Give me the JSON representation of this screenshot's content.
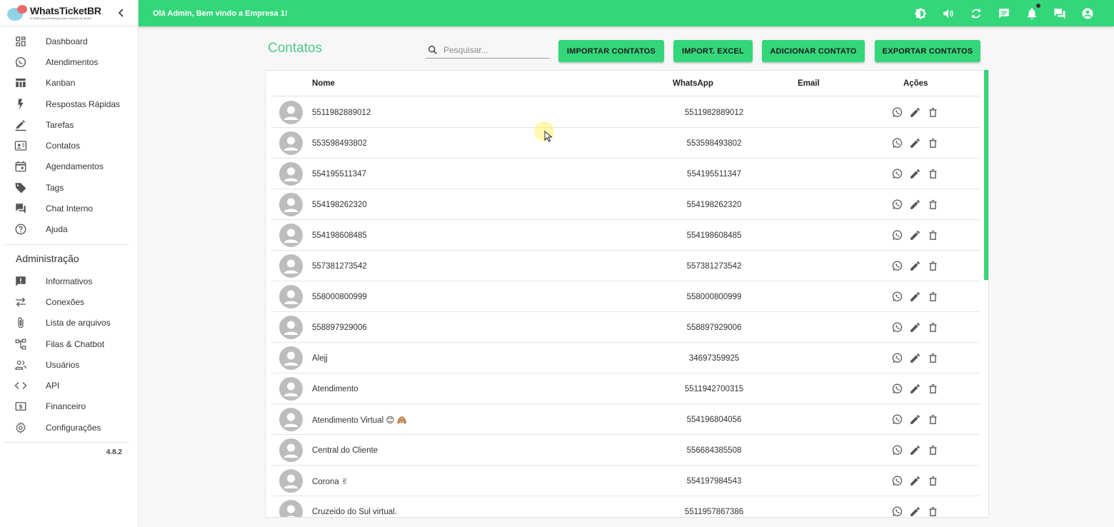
{
  "brand": {
    "name": "WhatsTicketBR",
    "tagline": "O CRM para WhatsApp mais completo do Brasil"
  },
  "sidebar": {
    "items": [
      {
        "label": "Dashboard",
        "icon": "dashboard-icon"
      },
      {
        "label": "Atendimentos",
        "icon": "whatsapp-icon"
      },
      {
        "label": "Kanban",
        "icon": "kanban-icon"
      },
      {
        "label": "Respostas Rápidas",
        "icon": "flash-icon"
      },
      {
        "label": "Tarefas",
        "icon": "edit-icon"
      },
      {
        "label": "Contatos",
        "icon": "contacts-icon"
      },
      {
        "label": "Agendamentos",
        "icon": "calendar-icon"
      },
      {
        "label": "Tags",
        "icon": "tag-icon"
      },
      {
        "label": "Chat Interno",
        "icon": "forum-icon"
      },
      {
        "label": "Ajuda",
        "icon": "help-icon"
      }
    ],
    "admin_heading": "Administração",
    "admin_items": [
      {
        "label": "Informativos",
        "icon": "announcement-icon"
      },
      {
        "label": "Conexões",
        "icon": "sync-alt-icon"
      },
      {
        "label": "Lista de arquivos",
        "icon": "attach-icon"
      },
      {
        "label": "Filas & Chatbot",
        "icon": "account-tree-icon"
      },
      {
        "label": "Usuários",
        "icon": "people-icon"
      },
      {
        "label": "API",
        "icon": "code-icon"
      },
      {
        "label": "Financeiro",
        "icon": "money-icon"
      },
      {
        "label": "Configurações",
        "icon": "settings-icon"
      }
    ],
    "version": "4.8.2"
  },
  "topbar": {
    "greeting": "Olá Admin, Bem vindo a Empresa 1!"
  },
  "main": {
    "title": "Contatos",
    "search_placeholder": "Pesquisar...",
    "buttons": {
      "import_contacts": "IMPORTAR CONTATOS",
      "import_excel": "IMPORT. EXCEL",
      "add_contact": "ADICIONAR CONTATO",
      "export_contacts": "EXPORTAR CONTATOS"
    }
  },
  "table": {
    "headers": {
      "name": "Nome",
      "whatsapp": "WhatsApp",
      "email": "Email",
      "actions": "Ações"
    },
    "rows": [
      {
        "name": "5511982889012",
        "whatsapp": "5511982889012",
        "email": ""
      },
      {
        "name": "553598493802",
        "whatsapp": "553598493802",
        "email": ""
      },
      {
        "name": "554195511347",
        "whatsapp": "554195511347",
        "email": ""
      },
      {
        "name": "554198262320",
        "whatsapp": "554198262320",
        "email": ""
      },
      {
        "name": "554198608485",
        "whatsapp": "554198608485",
        "email": ""
      },
      {
        "name": "557381273542",
        "whatsapp": "557381273542",
        "email": ""
      },
      {
        "name": "558000800999",
        "whatsapp": "558000800999",
        "email": ""
      },
      {
        "name": "558897929006",
        "whatsapp": "558897929006",
        "email": ""
      },
      {
        "name": "Alejj",
        "whatsapp": "34697359925",
        "email": ""
      },
      {
        "name": "Atendimento",
        "whatsapp": "5511942700315",
        "email": ""
      },
      {
        "name": "Atendimento Virtual 😊 🙈",
        "whatsapp": "554196804056",
        "email": ""
      },
      {
        "name": "Central do Cliente",
        "whatsapp": "556684385508",
        "email": ""
      },
      {
        "name": "Corona ✌",
        "whatsapp": "554197984543",
        "email": ""
      },
      {
        "name": "Cruzeido do Sul virtual.",
        "whatsapp": "5511957867386",
        "email": ""
      }
    ]
  },
  "colors": {
    "accent": "#34d67a",
    "title": "#4fc68a"
  }
}
